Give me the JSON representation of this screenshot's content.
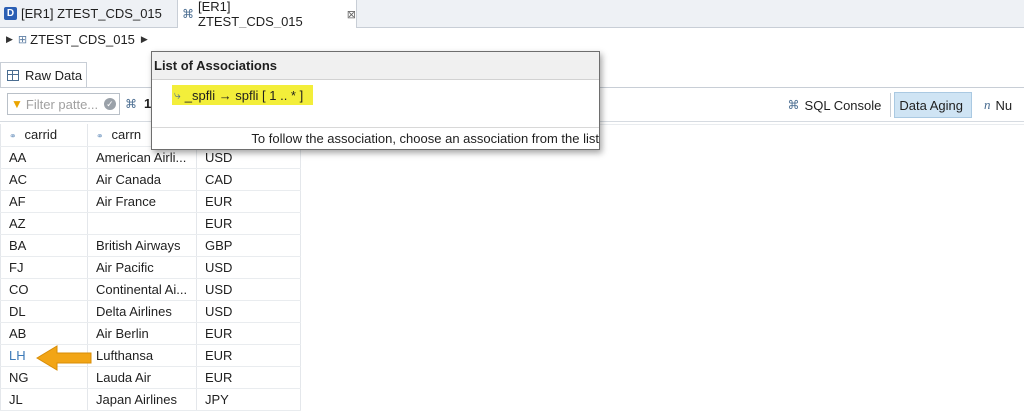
{
  "editor_tabs": [
    {
      "label": "[ER1] ZTEST_CDS_015",
      "icon": "ddl-source-icon"
    },
    {
      "label": "[ER1] ZTEST_CDS_015",
      "icon": "cds-view-icon",
      "close": "⊠"
    }
  ],
  "breadcrumb": {
    "label": "ZTEST_CDS_015"
  },
  "raw_data_tab": {
    "label": "Raw Data"
  },
  "toolbar": {
    "filter_placeholder": "Filter patte...",
    "count": "1",
    "sql_console": "SQL Console",
    "data_aging": "Data Aging",
    "number_label": "Nu"
  },
  "table": {
    "columns": [
      "carrid",
      "carrn",
      ""
    ],
    "rows": [
      [
        "AA",
        "American Airli...",
        "USD"
      ],
      [
        "AC",
        "Air Canada",
        "CAD"
      ],
      [
        "AF",
        "Air France",
        "EUR"
      ],
      [
        "AZ",
        "",
        "EUR"
      ],
      [
        "BA",
        "British Airways",
        "GBP"
      ],
      [
        "FJ",
        "Air Pacific",
        "USD"
      ],
      [
        "CO",
        "Continental Ai...",
        "USD"
      ],
      [
        "DL",
        "Delta Airlines",
        "USD"
      ],
      [
        "AB",
        "Air Berlin",
        "EUR"
      ],
      [
        "LH",
        "Lufthansa",
        "EUR"
      ],
      [
        "NG",
        "Lauda Air",
        "EUR"
      ],
      [
        "JL",
        "Japan Airlines",
        "JPY"
      ]
    ]
  },
  "popup": {
    "title": "List of Associations",
    "association": "_spfli → spfli [ 1 .. * ]",
    "hint": "To follow the association, choose an association from the list"
  },
  "colors": {
    "highlight": "#f3ee3a",
    "arrow": "#f2a516",
    "link": "#3d7ab8",
    "selected_button": "#cfe4f4"
  }
}
